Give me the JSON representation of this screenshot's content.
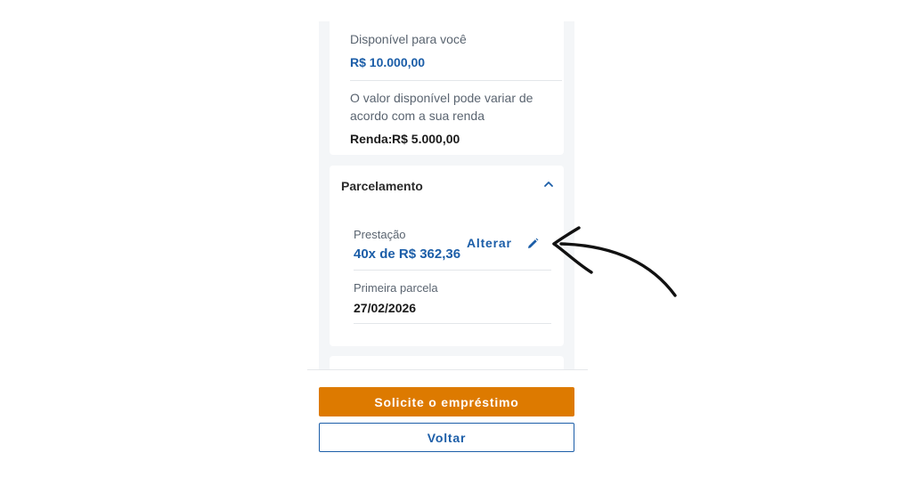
{
  "available": {
    "label": "Disponível para você",
    "amount": "R$ 10.000,00",
    "note_line1": "O valor disponível pode variar de",
    "note_line2": "acordo com a sua renda",
    "income_label": "Renda:",
    "income_value": "R$ 5.000,00"
  },
  "installments": {
    "title": "Parcelamento",
    "payment_label": "Prestação",
    "payment_value": "40x de R$ 362,36",
    "edit_label": "Alterar",
    "first_label": "Primeira parcela",
    "first_value": "27/02/2026"
  },
  "actions": {
    "primary_label": "Solicite o empréstimo",
    "secondary_label": "Voltar"
  },
  "colors": {
    "brand_blue": "#1c5ea8",
    "cta_orange": "#dd7a00"
  },
  "icons": {
    "chevron": "chevron-up-icon",
    "edit": "pencil-icon",
    "annotation": "arrow-annotation"
  }
}
